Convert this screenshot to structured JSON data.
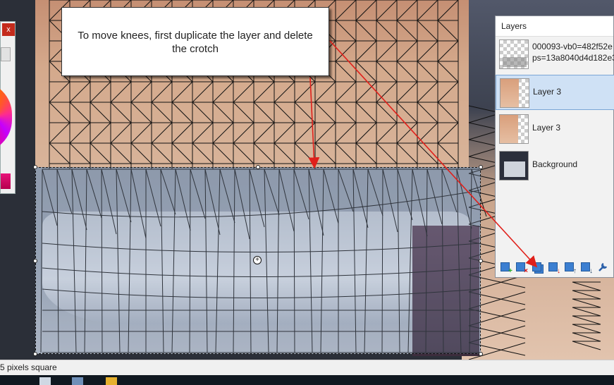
{
  "callout": {
    "text": "To move knees, first duplicate the layer and delete the crotch"
  },
  "palette": {
    "close_glyph": "x"
  },
  "layers_panel": {
    "title": "Layers",
    "layers": [
      {
        "name_line1": "000093-vb0=482f52e",
        "name_line2": "ps=13a8040d4d182e3",
        "selected": false
      },
      {
        "name": "Layer 3",
        "selected": true
      },
      {
        "name": "Layer 3",
        "selected": false
      },
      {
        "name": "Background",
        "selected": false
      }
    ],
    "toolbar": [
      {
        "icon": "add-layer-icon"
      },
      {
        "icon": "delete-layer-icon"
      },
      {
        "icon": "duplicate-layer-icon"
      },
      {
        "icon": "merge-layer-down-icon"
      },
      {
        "icon": "move-layer-up-icon"
      },
      {
        "icon": "move-layer-down-icon"
      },
      {
        "icon": "layer-properties-icon"
      }
    ]
  },
  "status": {
    "text": "5 pixels square"
  },
  "colors": {
    "accent": "#3c7fd1",
    "arrow": "#e0201b",
    "selection_bg": "#cfe1f5"
  }
}
